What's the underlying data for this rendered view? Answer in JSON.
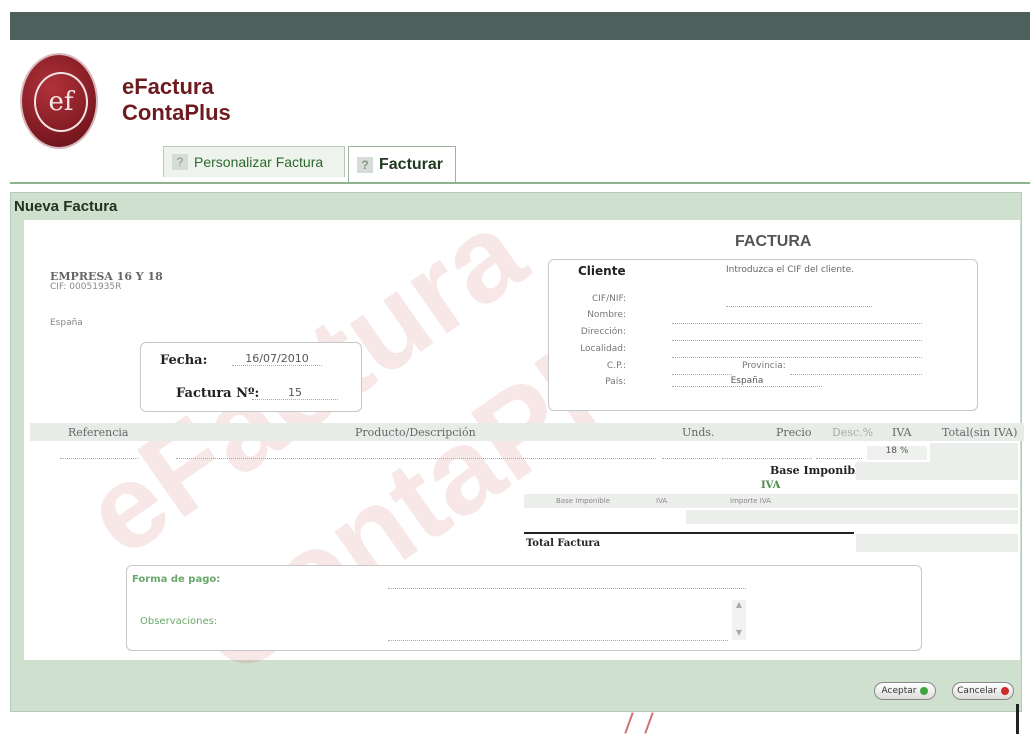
{
  "brand": {
    "line1": "eFactura",
    "line2": "ContaPlus"
  },
  "tabs": [
    {
      "label": "Personalizar Factura",
      "active": false
    },
    {
      "label": "Facturar",
      "active": true
    }
  ],
  "panel": {
    "title": "Nueva Factura"
  },
  "document": {
    "title": "FACTURA",
    "company": {
      "name": "EMPRESA 16 Y 18",
      "cif": "CIF: 00051935R",
      "country": "España"
    },
    "date_label": "Fecha:",
    "date_value": "16/07/2010",
    "number_label": "Factura Nº:",
    "number_value": "15"
  },
  "client": {
    "title": "Cliente",
    "hint": "Introduzca el CIF del cliente.",
    "labels": {
      "cif": "CIF/NIF:",
      "name": "Nombre:",
      "address": "Dirección:",
      "city": "Localidad:",
      "postcode": "C.P.:",
      "province": "Provincia:",
      "country": "País:"
    },
    "country_value": "España"
  },
  "table": {
    "headers": [
      "Referencia",
      "Producto/Descripción",
      "Unds.",
      "Precio",
      "Desc.%",
      "IVA",
      "Total(sin IVA)"
    ],
    "row_iva": "18 %"
  },
  "totals": {
    "base_label": "Base Imponible",
    "iva_title": "IVA",
    "iva_cols": [
      "Base Imponible",
      "IVA",
      "Importe IVA"
    ],
    "total_label": "Total Factura"
  },
  "payment": {
    "method_label": "Forma de pago:",
    "notes_label": "Observaciones:"
  },
  "buttons": {
    "accept": "Aceptar",
    "cancel": "Cancelar"
  },
  "colors": {
    "brand": "#6e1b20",
    "panel": "#cfe0cf",
    "topbar": "#4f5f5b"
  },
  "icons": {
    "accept": "green-arrow-icon",
    "cancel": "red-arrow-icon"
  }
}
